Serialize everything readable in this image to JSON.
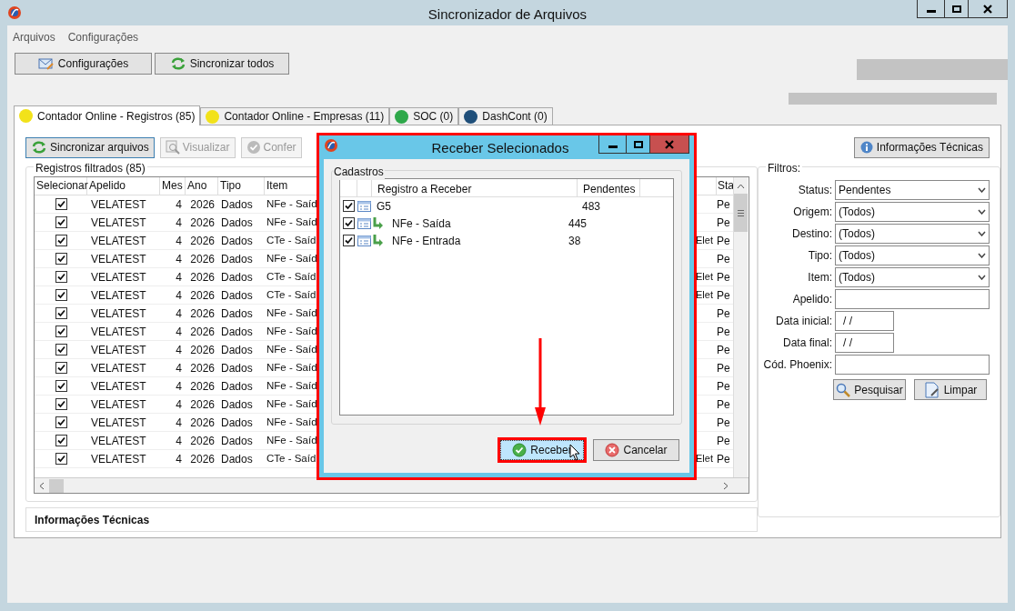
{
  "window": {
    "title": "Sincronizador de Arquivos"
  },
  "menu": [
    "Arquivos",
    "Configurações"
  ],
  "toolbar": [
    {
      "label": "Configurações",
      "kind": "config"
    },
    {
      "label": "Sincronizar todos",
      "kind": "sync"
    }
  ],
  "tabs": [
    {
      "label": "Contador Online - Registros (85)",
      "selected": true,
      "color": "#f2e21a"
    },
    {
      "label": "Contador Online - Empresas (11)",
      "selected": false,
      "color": "#f2e21a"
    },
    {
      "label": "SOC (0)",
      "selected": false,
      "color": "#2ea84a"
    },
    {
      "label": "DashCont (0)",
      "selected": false,
      "color": "#1f4f7a"
    }
  ],
  "actions": [
    {
      "label": "Sincronizar arquivos",
      "disabled": false,
      "kind": "sync"
    },
    {
      "label": "Visualizar",
      "disabled": true,
      "kind": "view"
    },
    {
      "label": "Confer",
      "disabled": true,
      "kind": "check"
    }
  ],
  "info_button": "Informações Técnicas",
  "grid": {
    "title": "Registros filtrados (85)",
    "columns": [
      "Selecionar",
      "Apelido",
      "Mes",
      "Ano",
      "Tipo",
      "Item"
    ],
    "status_column": "Sta",
    "rows": [
      {
        "checked": true,
        "apelido": "VELATEST",
        "mes": "4",
        "ano": "2026",
        "tipo": "Dados",
        "item": "NFe - Saíd",
        "status": "Pe"
      },
      {
        "checked": true,
        "apelido": "VELATEST",
        "mes": "4",
        "ano": "2026",
        "tipo": "Dados",
        "item": "NFe - Saíd",
        "status": "Pe"
      },
      {
        "checked": true,
        "apelido": "VELATEST",
        "mes": "4",
        "ano": "2026",
        "tipo": "Dados",
        "item": "CTe - Saíd",
        "column_7": "Elet",
        "status": "Pe"
      },
      {
        "checked": true,
        "apelido": "VELATEST",
        "mes": "4",
        "ano": "2026",
        "tipo": "Dados",
        "item": "NFe - Saíd",
        "status": "Pe"
      },
      {
        "checked": true,
        "apelido": "VELATEST",
        "mes": "4",
        "ano": "2026",
        "tipo": "Dados",
        "item": "CTe - Saíd",
        "column_7": "Elet",
        "status": "Pe"
      },
      {
        "checked": true,
        "apelido": "VELATEST",
        "mes": "4",
        "ano": "2026",
        "tipo": "Dados",
        "item": "CTe - Saíd",
        "column_7": "Elet",
        "status": "Pe"
      },
      {
        "checked": true,
        "apelido": "VELATEST",
        "mes": "4",
        "ano": "2026",
        "tipo": "Dados",
        "item": "NFe - Saíd",
        "status": "Pe"
      },
      {
        "checked": true,
        "apelido": "VELATEST",
        "mes": "4",
        "ano": "2026",
        "tipo": "Dados",
        "item": "NFe - Saíd",
        "status": "Pe"
      },
      {
        "checked": true,
        "apelido": "VELATEST",
        "mes": "4",
        "ano": "2026",
        "tipo": "Dados",
        "item": "NFe - Saíd",
        "status": "Pe"
      },
      {
        "checked": true,
        "apelido": "VELATEST",
        "mes": "4",
        "ano": "2026",
        "tipo": "Dados",
        "item": "NFe - Saíd",
        "status": "Pe"
      },
      {
        "checked": true,
        "apelido": "VELATEST",
        "mes": "4",
        "ano": "2026",
        "tipo": "Dados",
        "item": "NFe - Saíd",
        "status": "Pe"
      },
      {
        "checked": true,
        "apelido": "VELATEST",
        "mes": "4",
        "ano": "2026",
        "tipo": "Dados",
        "item": "NFe - Saíd",
        "status": "Pe"
      },
      {
        "checked": true,
        "apelido": "VELATEST",
        "mes": "4",
        "ano": "2026",
        "tipo": "Dados",
        "item": "NFe - Saíd",
        "status": "Pe"
      },
      {
        "checked": true,
        "apelido": "VELATEST",
        "mes": "4",
        "ano": "2026",
        "tipo": "Dados",
        "item": "NFe - Saíd",
        "status": "Pe"
      },
      {
        "checked": true,
        "apelido": "VELATEST",
        "mes": "4",
        "ano": "2026",
        "tipo": "Dados",
        "item": "CTe - Saíd",
        "column_7": "Elet",
        "status": "Pe"
      }
    ]
  },
  "details": {
    "title": "Informações Técnicas"
  },
  "filters": {
    "title": "Filtros:",
    "fields": [
      {
        "label": "Status:",
        "kind": "select",
        "value": "Pendentes"
      },
      {
        "label": "Origem:",
        "kind": "select",
        "value": "(Todos)"
      },
      {
        "label": "Destino:",
        "kind": "select",
        "value": "(Todos)"
      },
      {
        "label": "Tipo:",
        "kind": "select",
        "value": "(Todos)"
      },
      {
        "label": "Item:",
        "kind": "select",
        "value": "(Todos)"
      },
      {
        "label": "Apelido:",
        "kind": "text"
      },
      {
        "label": "Data inicial:",
        "kind": "date",
        "value": "/ /"
      },
      {
        "label": "Data final:",
        "kind": "date",
        "value": "/ /"
      },
      {
        "label": "Cód. Phoenix:",
        "kind": "text"
      }
    ],
    "buttons": [
      {
        "label": "Pesquisar",
        "kind": "search"
      },
      {
        "label": "Limpar",
        "kind": "clear"
      }
    ]
  },
  "dialog": {
    "title": "Receber Selecionados",
    "group": "Cadastros",
    "columns": [
      "Registro a Receber",
      "Pendentes"
    ],
    "rows": [
      {
        "checked": true,
        "label": "G5",
        "pendentes": "483",
        "children": [
          {
            "checked": true,
            "label": "NFe - Saída",
            "pendentes": "445"
          },
          {
            "checked": true,
            "label": "NFe - Entrada",
            "pendentes": "38"
          }
        ]
      }
    ],
    "buttons": [
      {
        "label": "Receber",
        "kind": "ok",
        "focused": true
      },
      {
        "label": "Cancelar",
        "kind": "cancel",
        "focused": false
      }
    ]
  }
}
